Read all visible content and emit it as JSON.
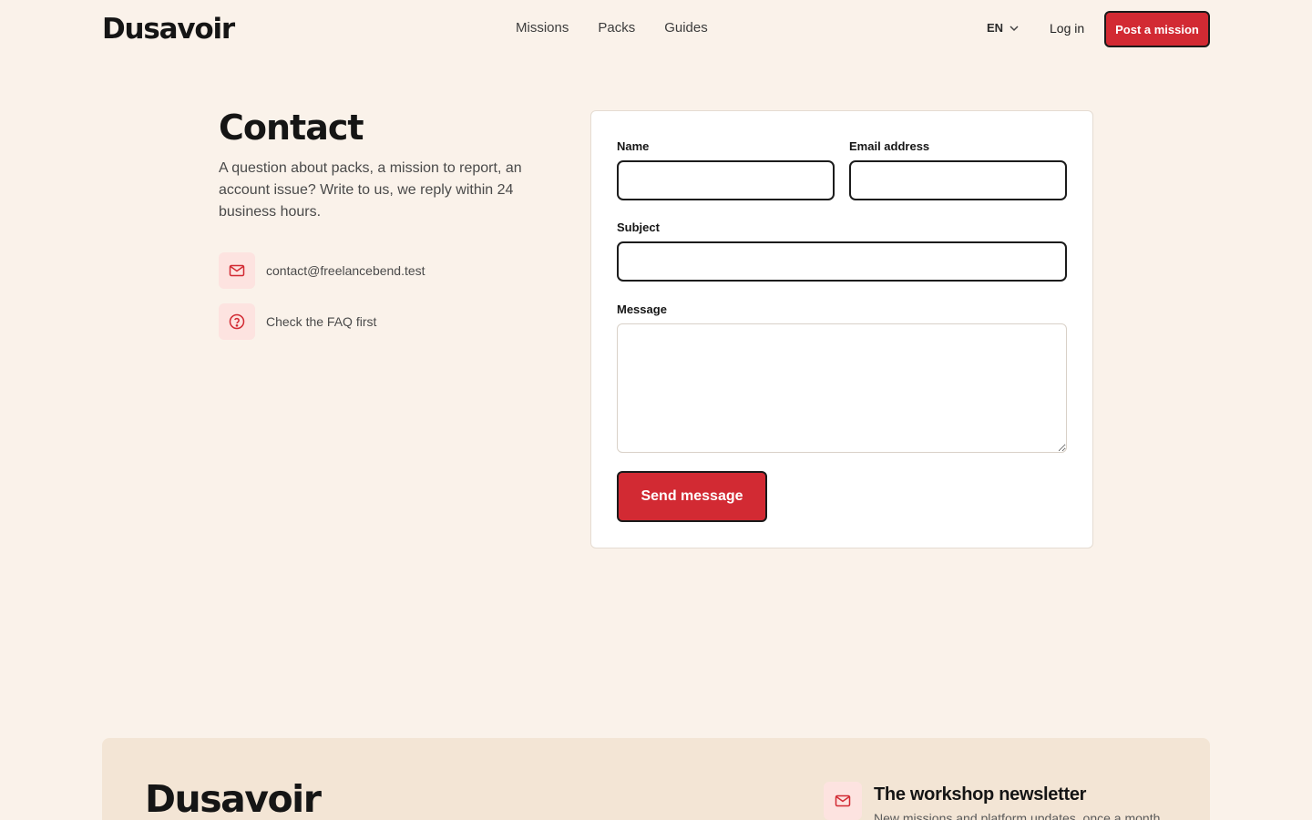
{
  "brand": {
    "name": "Dusavoir",
    "accent": "#d22a33",
    "background": "#faf2ea"
  },
  "header": {
    "nav": [
      "Missions",
      "Packs",
      "Guides"
    ],
    "language": "EN",
    "login_label": "Log in",
    "cta_label": "Post a mission"
  },
  "contact": {
    "title": "Contact",
    "description": "A question about packs, a mission to report, an account issue? Write to us, we reply within 24 business hours.",
    "email": {
      "icon": "mail-icon",
      "text": "contact@freelancebend.test"
    },
    "faq": {
      "icon": "help-circle-icon",
      "text": "Check the FAQ first"
    }
  },
  "form": {
    "name_label": "Name",
    "name_value": "",
    "email_label": "Email address",
    "email_value": "",
    "subject_label": "Subject",
    "subject_value": "",
    "message_label": "Message",
    "message_value": "",
    "submit_label": "Send message"
  },
  "footer": {
    "logo": "Dusavoir",
    "newsletter_icon": "mail-icon",
    "newsletter_title": "The workshop newsletter",
    "newsletter_subtitle": "New missions and platform updates, once a month."
  }
}
